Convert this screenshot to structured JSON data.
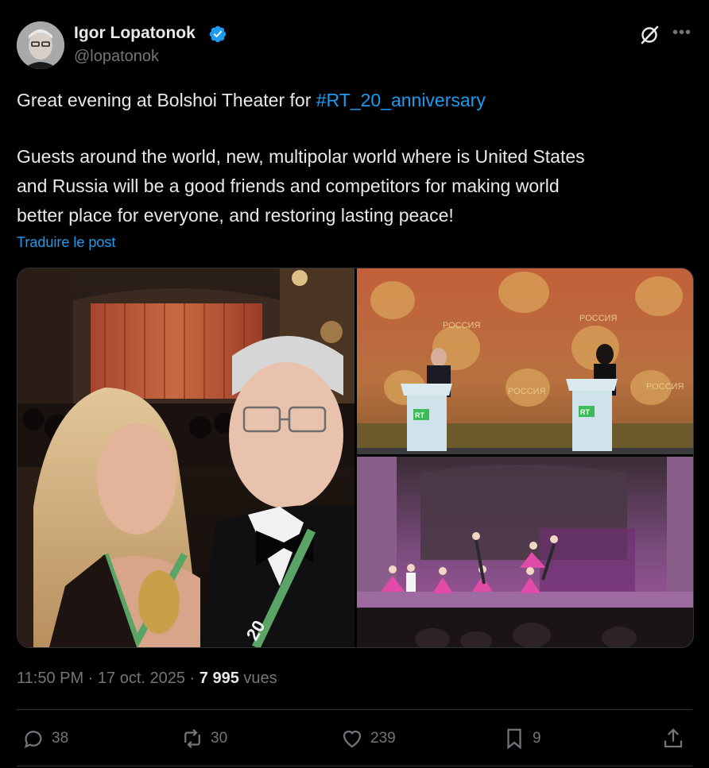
{
  "author": {
    "name": "Igor Lopatonok",
    "handle": "@lopatonok"
  },
  "post": {
    "line1_prefix": "Great evening at Bolshoi Theater for ",
    "hashtag": "#RT_20_anniversary",
    "line2": "Guests around the world, new, multipolar world where is United States",
    "line3": "and Russia will be a good friends and competitors for making world",
    "line4": "better place for everyone, and restoring lasting peace!",
    "translate_label": "Traduire le post"
  },
  "media": {
    "podium_logo": "RT",
    "curtain_text": "РОССИЯ"
  },
  "meta": {
    "time": "11:50 PM",
    "separator": " · ",
    "date": "17 oct. 2025",
    "views_count": "7 995",
    "views_label": " vues"
  },
  "actions": {
    "replies": "38",
    "reposts": "30",
    "likes": "239",
    "bookmarks": "9"
  },
  "colors": {
    "background": "#000000",
    "text": "#e7e9ea",
    "secondary": "#71767b",
    "link": "#1d9bf0",
    "border": "#2f3336"
  }
}
